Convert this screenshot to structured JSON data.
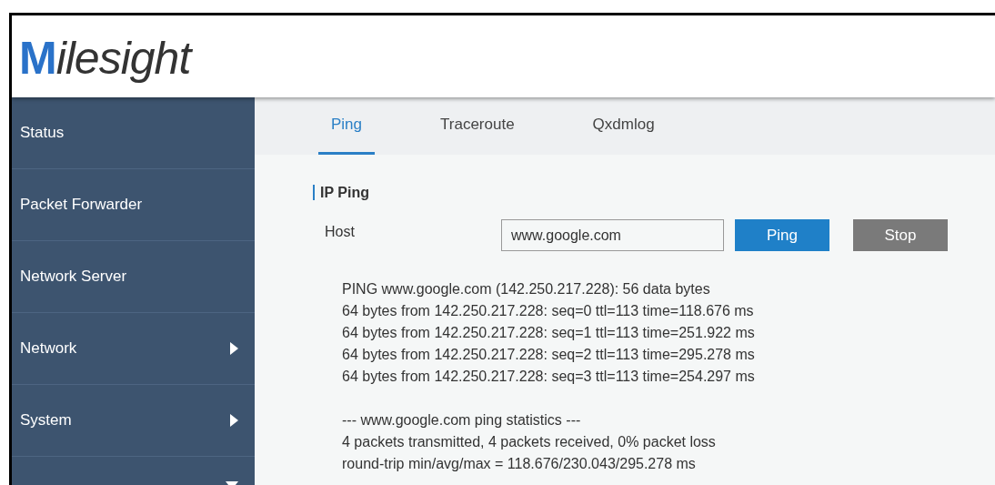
{
  "logo": {
    "text": "Milesight"
  },
  "sidebar": {
    "items": [
      {
        "label": "Status",
        "kind": "plain"
      },
      {
        "label": "Packet Forwarder",
        "kind": "plain"
      },
      {
        "label": "Network Server",
        "kind": "plain"
      },
      {
        "label": "Network",
        "kind": "submenu",
        "expanded": false
      },
      {
        "label": "System",
        "kind": "submenu",
        "expanded": false
      },
      {
        "kind": "submenu",
        "expanded": true
      }
    ]
  },
  "tabs": [
    {
      "label": "Ping",
      "selected": true
    },
    {
      "label": "Traceroute",
      "selected": false
    },
    {
      "label": "Qxdmlog",
      "selected": false
    }
  ],
  "section": {
    "title": "IP Ping"
  },
  "host": {
    "label": "Host",
    "value": "www.google.com"
  },
  "buttons": [
    {
      "label": "Ping",
      "kind": "primary"
    },
    {
      "label": "Stop",
      "kind": "secondary"
    }
  ],
  "output": {
    "blocks": [
      [
        "PING www.google.com (142.250.217.228): 56 data bytes",
        "64 bytes from 142.250.217.228: seq=0 ttl=113 time=118.676 ms",
        "64 bytes from 142.250.217.228: seq=1 ttl=113 time=251.922 ms",
        "64 bytes from 142.250.217.228: seq=2 ttl=113 time=295.278 ms",
        "64 bytes from 142.250.217.228: seq=3 ttl=113 time=254.297 ms"
      ],
      [
        "--- www.google.com ping statistics ---",
        "4 packets transmitted, 4 packets received, 0% packet loss",
        "round-trip min/avg/max = 118.676/230.043/295.278 ms"
      ]
    ]
  }
}
